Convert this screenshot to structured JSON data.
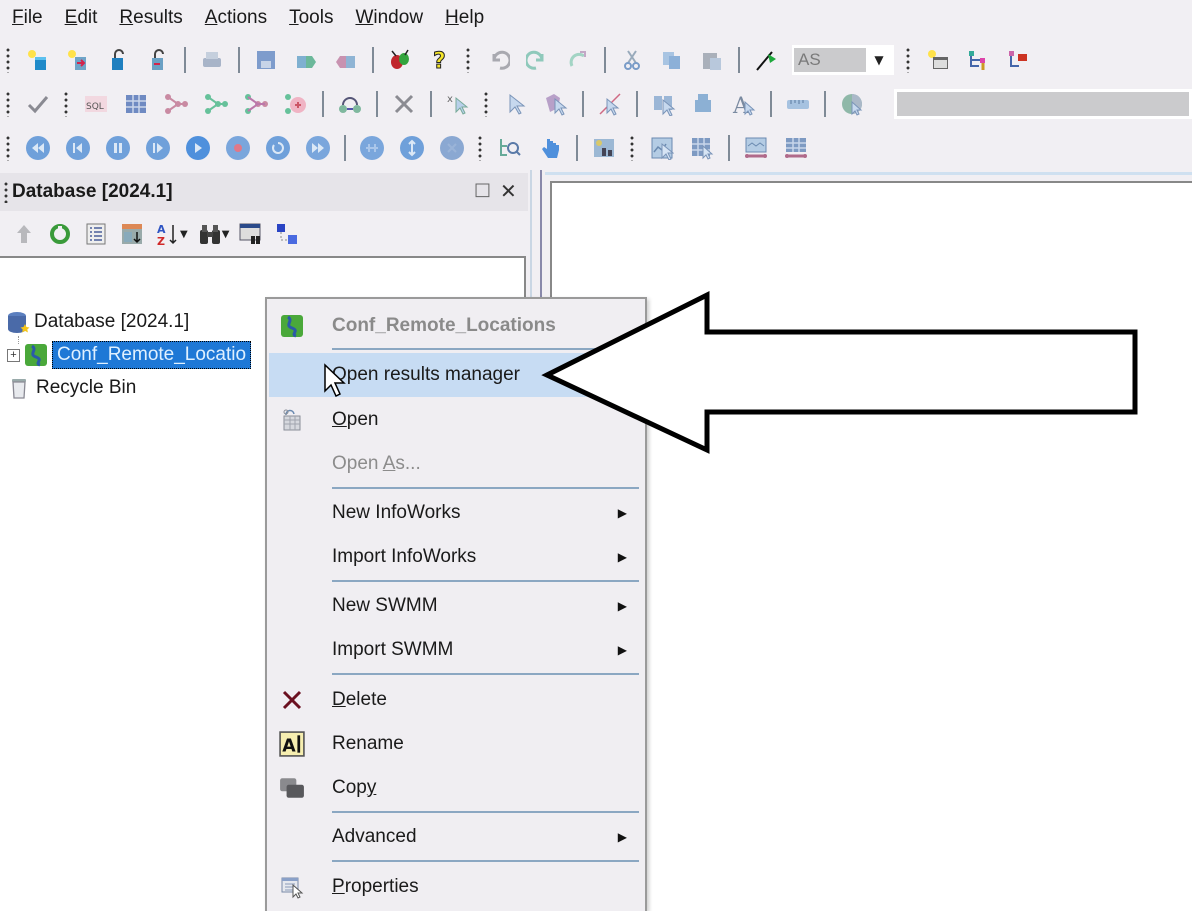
{
  "menubar": {
    "items": [
      {
        "label": "File",
        "accel": "F",
        "rest": "ile"
      },
      {
        "label": "Edit",
        "accel": "E",
        "rest": "dit"
      },
      {
        "label": "Results",
        "accel": "R",
        "rest": "esults"
      },
      {
        "label": "Actions",
        "accel": "A",
        "rest": "ctions"
      },
      {
        "label": "Tools",
        "accel": "T",
        "rest": "ools"
      },
      {
        "label": "Window",
        "accel": "W",
        "rest": "indow"
      },
      {
        "label": "Help",
        "accel": "H",
        "rest": "elp"
      }
    ]
  },
  "toolbar1": {
    "scenario_combo_value": "AS"
  },
  "panel": {
    "title": "Database [2024.1]",
    "restore_label": "□",
    "close_label": "✕"
  },
  "tree": {
    "root": "Database [2024.1]",
    "items": [
      {
        "label": "Conf_Remote_Locatio",
        "selected": true,
        "expander": "+"
      },
      {
        "label": "Recycle Bin",
        "selected": false
      }
    ]
  },
  "context_menu": {
    "header": "Conf_Remote_Locations",
    "items": [
      {
        "label": "Open results manager",
        "state": "hover"
      },
      {
        "label": "Open",
        "state": "normal"
      },
      {
        "label": "Open As...",
        "state": "disabled"
      },
      {
        "label": "New InfoWorks",
        "submenu": true
      },
      {
        "label": "Import InfoWorks",
        "submenu": true
      },
      {
        "label": "New SWMM",
        "submenu": true
      },
      {
        "label": "Import SWMM",
        "submenu": true
      },
      {
        "label": "Delete",
        "state": "normal"
      },
      {
        "label": "Rename",
        "state": "normal"
      },
      {
        "label": "Copy",
        "state": "normal"
      },
      {
        "label": "Advanced",
        "submenu": true
      },
      {
        "label": "Properties",
        "state": "normal"
      }
    ],
    "submenu_glyph": "▶"
  },
  "colors": {
    "selection": "#1e78d6",
    "menu_hover": "#c7dcf3",
    "menu_separator": "#8ba7c2",
    "background": "#f1eff3"
  }
}
